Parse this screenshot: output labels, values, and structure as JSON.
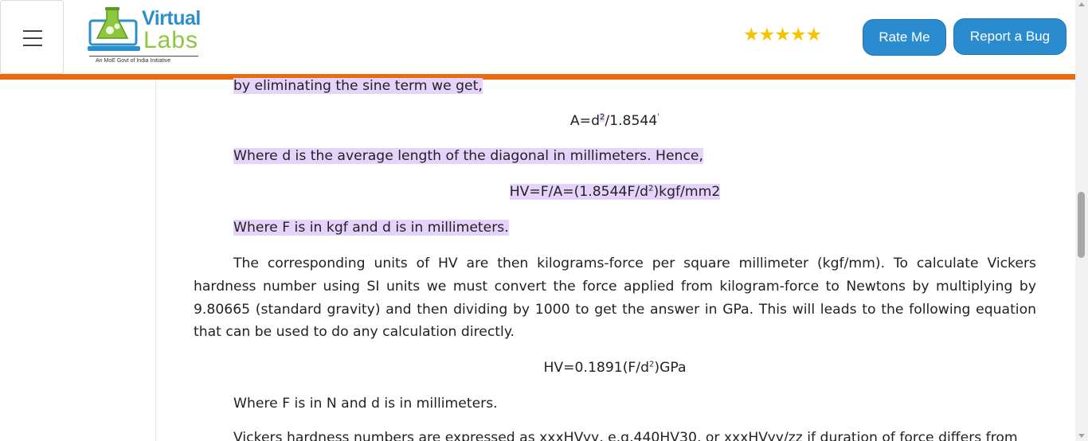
{
  "header": {
    "logo_title": "Virtual",
    "logo_subtitle": "Labs",
    "logo_tagline": "An MoE Govt of India Initiative",
    "rating_stars": 5,
    "stars_text": "★★★★★",
    "rate_button": "Rate Me",
    "report_button": "Report a Bug"
  },
  "colors": {
    "accent_orange": "#ec6a0e",
    "button_blue": "#2a8ccf",
    "highlight": "#e6d3fb",
    "star_yellow": "#f5c400"
  },
  "icons": {
    "menu": "hamburger-menu-icon",
    "logo": "virtual-labs-logo"
  },
  "content": {
    "line1": "by eliminating the sine term we get,",
    "eq1_a": "A=d",
    "eq1_sup": "2",
    "eq1_b": "/1.8544",
    "eq1_c": "ʹ",
    "line2": "Where d is the average length of the diagonal in millimeters. Hence,",
    "eq2_a": "HV=F/A=(1.8544F/d",
    "eq2_sup": "2",
    "eq2_b": ")kgf/mm2",
    "line3": "Where F is in kgf and d is in millimeters.",
    "para1": "The corresponding units of HV are then kilograms-force per square millimeter (kgf/mm). To calculate Vickers hardness number using SI units we must convert the force applied from kilogram-force to Newtons by multiplying by 9.80665 (standard gravity) and then dividing by 1000 to get the answer in GPa. This will leads to the following equation that can be used to do any calculation directly.",
    "eq3_a": "HV=0.1891(F/d",
    "eq3_sup": "2",
    "eq3_b": ")GPa",
    "line4": "Where F is in N and d is in millimeters.",
    "line5": "Vickers hardness numbers are expressed as xxxHVyy, e.g.440HV30, or xxxHVyy/zz if duration of force differs from"
  }
}
